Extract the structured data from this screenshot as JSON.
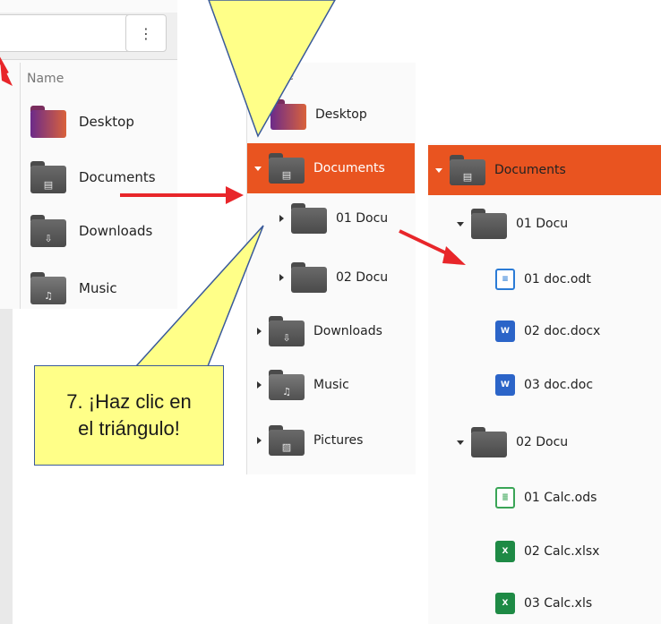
{
  "left_view": {
    "menu_icon": "vertical-dots-icon",
    "column_header": "Name",
    "items": [
      {
        "label": "Desktop",
        "icon": "desktop-folder-icon"
      },
      {
        "label": "Documents",
        "icon": "documents-folder-icon"
      },
      {
        "label": "Downloads",
        "icon": "downloads-folder-icon"
      },
      {
        "label": "Music",
        "icon": "music-folder-icon"
      }
    ]
  },
  "middle_view": {
    "column_header_fragment": "e",
    "items": [
      {
        "label": "Desktop"
      },
      {
        "label": "Documents"
      },
      {
        "label": "01 Docu"
      },
      {
        "label": "02 Docu"
      },
      {
        "label": "Downloads"
      },
      {
        "label": "Music"
      },
      {
        "label": "Pictures"
      }
    ]
  },
  "right_view": {
    "items": [
      {
        "label": "Documents"
      },
      {
        "label": "01 Docu"
      },
      {
        "label": "01 doc.odt"
      },
      {
        "label": "02 doc.docx"
      },
      {
        "label": "03 doc.doc"
      },
      {
        "label": "02 Docu"
      },
      {
        "label": "01 Calc.ods"
      },
      {
        "label": "02 Calc.xlsx"
      },
      {
        "label": "03 Calc.xls"
      }
    ]
  },
  "callout": {
    "line1": "7. ¡Haz clic en",
    "line2": "el triángulo!"
  },
  "colors": {
    "selection": "#e95420",
    "callout_fill": "#ffff88",
    "arrow": "#e8262a"
  }
}
